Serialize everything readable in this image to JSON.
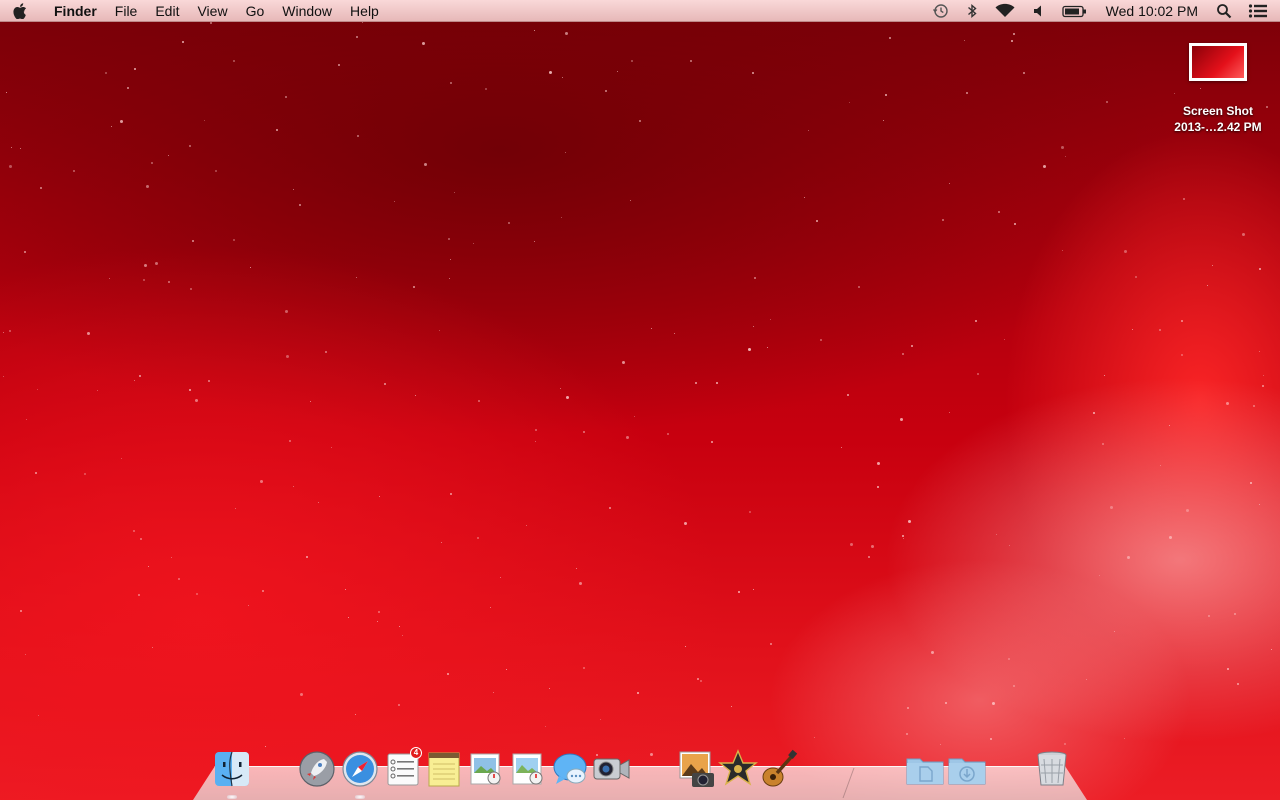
{
  "menubar": {
    "app_name": "Finder",
    "items": [
      "File",
      "Edit",
      "View",
      "Go",
      "Window",
      "Help"
    ],
    "status_icons": [
      "time-machine-icon",
      "bluetooth-icon",
      "wifi-icon",
      "volume-icon",
      "battery-icon"
    ],
    "clock": "Wed 10:02 PM",
    "right_icons": [
      "spotlight-icon",
      "notification-center-icon"
    ]
  },
  "desktop": {
    "icons": [
      {
        "label_line1": "Screen Shot",
        "label_line2": "2013-…2.42 PM"
      }
    ]
  },
  "dock": {
    "apps": [
      {
        "name": "Finder",
        "icon": "finder-icon"
      },
      {
        "name": "Launchpad",
        "icon": "launchpad-icon"
      },
      {
        "name": "Safari",
        "icon": "safari-icon"
      },
      {
        "name": "Reminders",
        "icon": "reminders-icon",
        "badge": "4"
      },
      {
        "name": "Notes",
        "icon": "notes-icon"
      },
      {
        "name": "Preview",
        "icon": "preview-icon"
      },
      {
        "name": "Preview 2",
        "icon": "preview-doc-icon"
      },
      {
        "name": "Messages",
        "icon": "messages-icon"
      },
      {
        "name": "FaceTime",
        "icon": "facetime-icon"
      },
      {
        "name": "iPhoto",
        "icon": "iphoto-icon"
      },
      {
        "name": "iMovie",
        "icon": "imovie-icon"
      },
      {
        "name": "GarageBand",
        "icon": "garageband-icon"
      },
      {
        "name": "Documents",
        "icon": "documents-folder-icon"
      },
      {
        "name": "Downloads",
        "icon": "downloads-folder-icon"
      },
      {
        "name": "Trash",
        "icon": "trash-icon"
      }
    ]
  },
  "colors": {
    "wallpaper_dark": "#7a0008",
    "wallpaper_bright": "#ec1d25",
    "menubar_tint": "#f2cdcd",
    "badge": "#e21b1b"
  }
}
